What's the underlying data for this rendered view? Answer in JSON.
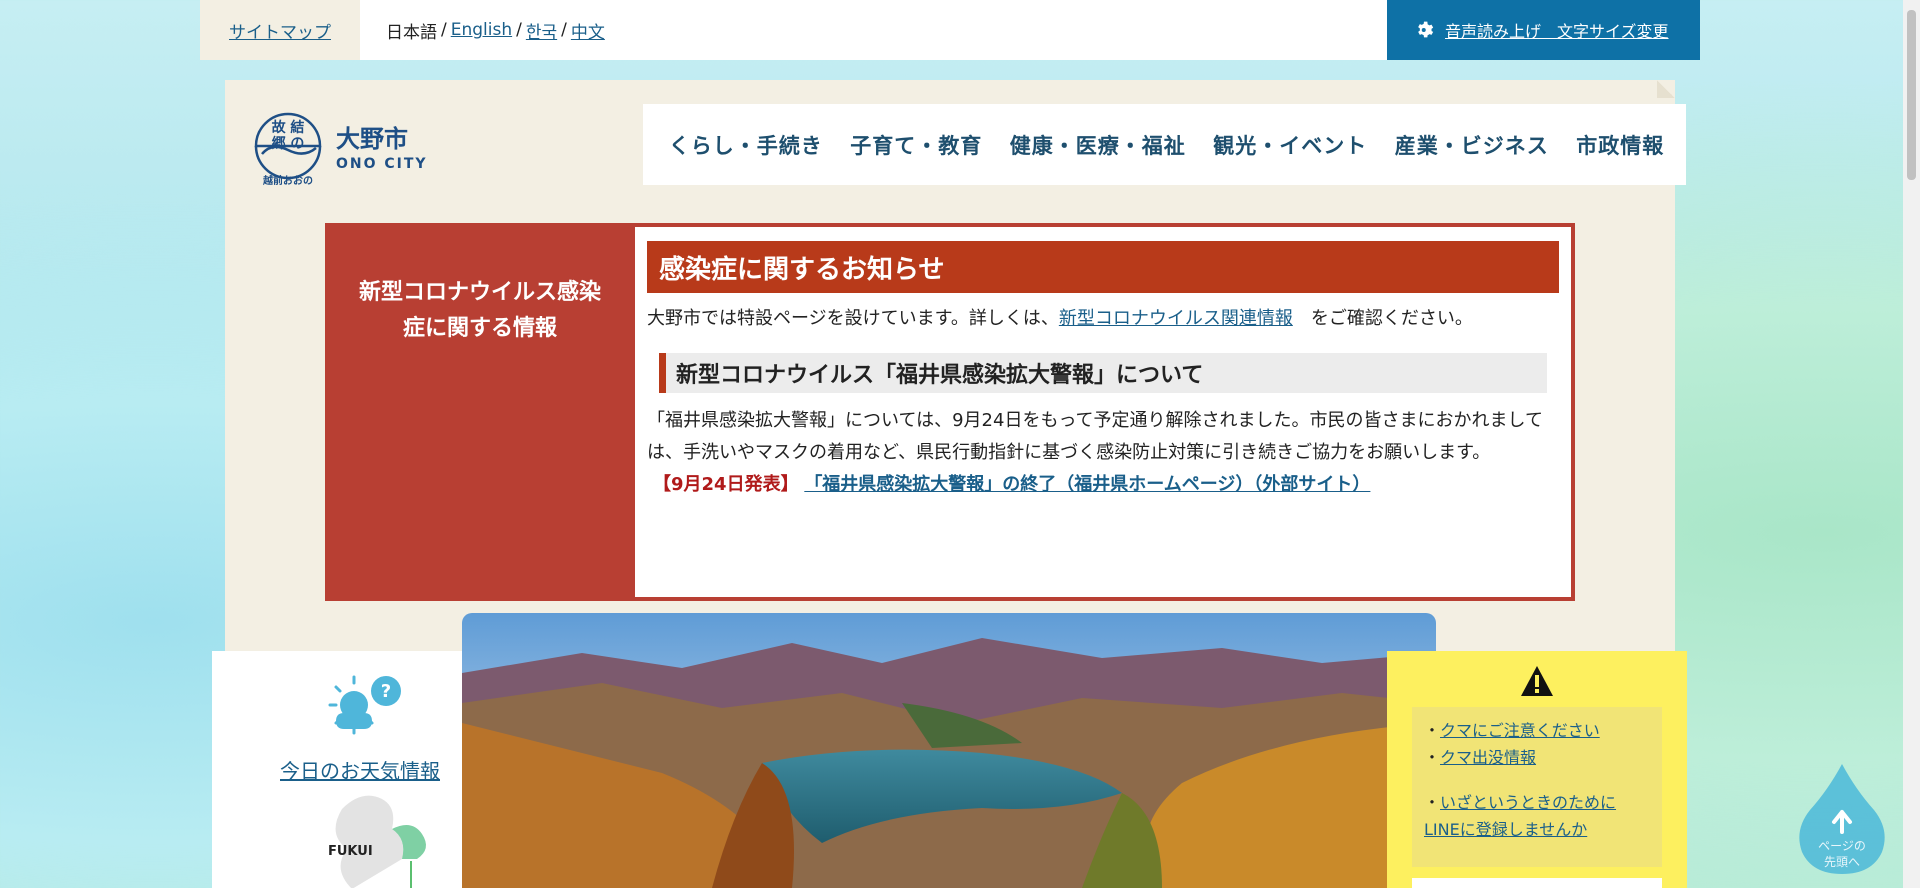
{
  "topbar": {
    "sitemap": "サイトマップ",
    "lang_current": "日本語",
    "langs": [
      "English",
      "한국",
      "中文"
    ],
    "voice_label": "音声読み上げ　文字サイズ変更"
  },
  "logo": {
    "mark_text": "故郷の結",
    "mark_sub": "越前おおの",
    "name_jp": "大野市",
    "name_en": "ONO CITY"
  },
  "gnav": [
    "くらし・手続き",
    "子育て・教育",
    "健康・医療・福祉",
    "観光・イベント",
    "産業・ビジネス",
    "市政情報"
  ],
  "corona": {
    "side_title_1": "新型コロナウイルス感染",
    "side_title_2": "症に関する情報",
    "heading": "感染症に関するお知らせ",
    "lead_pre": "大野市では特設ページを設けています。詳しくは、",
    "lead_link": "新型コロナウイルス関連情報",
    "lead_post": "　をご確認ください。",
    "subheading": "新型コロナウイルス「福井県感染拡大警報」について",
    "body": "「福井県感染拡大警報」については、9月24日をもって予定通り解除されました。市民の皆さまにおかれましては、手洗いやマスクの着用など、県民行動指針に基づく感染防止対策に引き続きご協力をお願いします。",
    "release_tag": "【9月24日発表】",
    "release_link": "「福井県感染拡大警報」の終了（福井県ホームページ）（外部サイト）"
  },
  "weather": {
    "link": "今日のお天気情報",
    "map_label": "FUKUI"
  },
  "alerts": {
    "items": [
      "クマにご注意ください",
      "クマ出没情報",
      "いざというときのためにLINEに登録しませんか"
    ]
  },
  "totop": {
    "line1": "ページの",
    "line2": "先頭へ"
  },
  "colors": {
    "accent_blue": "#0e71a6",
    "notice_red": "#b83f33",
    "alert_yellow": "#fdf05f"
  }
}
